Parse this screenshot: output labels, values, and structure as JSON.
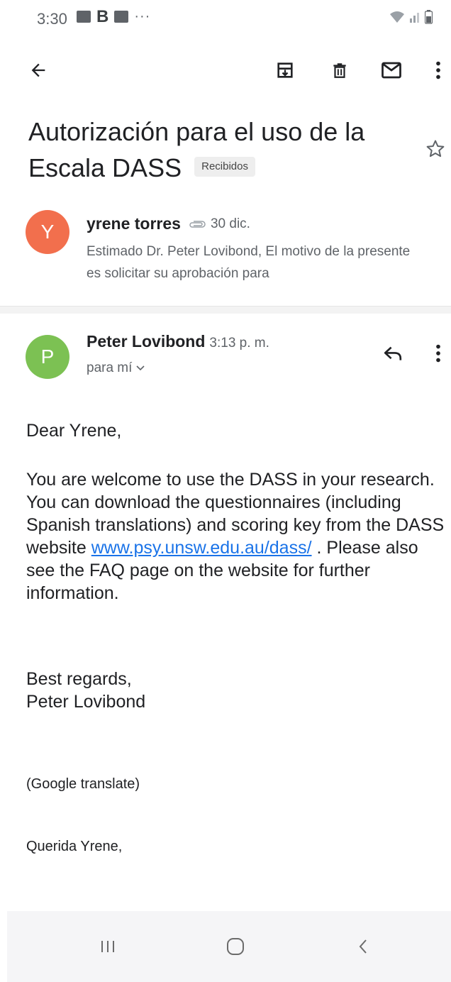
{
  "status_bar": {
    "time": "3:30",
    "b_label": "B",
    "overflow": "···",
    "icons": [
      "gallery-icon",
      "message-icon",
      "wifi-icon",
      "signal-icon",
      "battery-icon"
    ]
  },
  "toolbar": {
    "icons": [
      "back-arrow-icon",
      "archive-icon",
      "delete-icon",
      "mark-unread-icon",
      "more-vert-icon"
    ]
  },
  "email": {
    "subject": "Autorización para el uso de la Escala DASS",
    "label": "Recibidos",
    "starred": false
  },
  "messages": [
    {
      "avatar_letter": "Y",
      "avatar_color": "#f26f4d",
      "sender": "yrene torres",
      "has_attachment": true,
      "date": "30 dic.",
      "snippet": "Estimado Dr. Peter Lovibond, El motivo de la presente es solicitar su aprobación para"
    },
    {
      "avatar_letter": "P",
      "avatar_color": "#7cc153",
      "sender": "Peter Lovibond",
      "time": "3:13 p. m.",
      "recipient": "para mí",
      "body": {
        "greeting": "Dear Yrene,",
        "paragraph_before_link": "You are welcome to use the DASS in your research.  You can download the questionnaires (including Spanish translations) and scoring key from the DASS website",
        "link": "www.psy.unsw.edu.au/dass/",
        "paragraph_after_link": ".  Please also see the FAQ page on the website for further information.",
        "closing": "Best regards,",
        "signature": "Peter Lovibond",
        "translate_note": "(Google translate)",
        "translated_greeting": "Querida Yrene,"
      }
    }
  ],
  "colors": {
    "link": "#1a73e8",
    "muted_text": "#5f6368",
    "divider": "#f3f3f3"
  },
  "nav_bar": {
    "icons": [
      "recents-icon",
      "home-icon",
      "back-nav-icon"
    ]
  }
}
